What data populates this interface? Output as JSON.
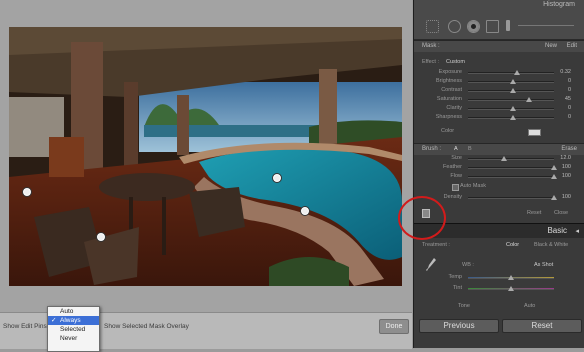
{
  "panel": {
    "title": "Histogram",
    "mask": {
      "label": "Mask :",
      "new": "New",
      "edit": "Edit"
    },
    "effect": {
      "label": "Effect :",
      "preset": "Custom"
    },
    "sliders": [
      {
        "label": "Exposure",
        "value": "0.32",
        "pos": 0.55
      },
      {
        "label": "Brightness",
        "value": "0",
        "pos": 0.5
      },
      {
        "label": "Contrast",
        "value": "0",
        "pos": 0.5
      },
      {
        "label": "Saturation",
        "value": "45",
        "pos": 0.7
      },
      {
        "label": "Clarity",
        "value": "0",
        "pos": 0.5
      },
      {
        "label": "Sharpness",
        "value": "0",
        "pos": 0.5
      }
    ],
    "color_label": "Color",
    "brush": {
      "label": "Brush :",
      "a": "A",
      "b": "B",
      "erase": "Erase"
    },
    "brush_sliders": [
      {
        "label": "Size",
        "value": "12.0",
        "pos": 0.4
      },
      {
        "label": "Feather",
        "value": "100",
        "pos": 1.0
      },
      {
        "label": "Flow",
        "value": "100",
        "pos": 1.0
      }
    ],
    "auto_mask": "Auto Mask",
    "density": {
      "label": "Density",
      "value": "100",
      "pos": 1.0
    },
    "reset": "Reset",
    "close": "Close",
    "basic": "Basic",
    "treatment": {
      "label": "Treatment :",
      "color": "Color",
      "bw": "Black & White"
    },
    "wb": {
      "label": "WB :",
      "value": "As Shot"
    },
    "temp": {
      "label": "Temp",
      "pos": 0.5
    },
    "tint": {
      "label": "Tint",
      "pos": 0.5
    },
    "tone": "Tone",
    "auto": "Auto",
    "previous": "Previous",
    "reset_btn": "Reset"
  },
  "toolbar": {
    "show_edit_pins": "Show Edit Pins :",
    "show_mask": "Show Selected Mask Overlay",
    "done": "Done"
  },
  "pin_menu": {
    "options": [
      "Auto",
      "Always",
      "Selected",
      "Never"
    ],
    "selected": "Always"
  }
}
